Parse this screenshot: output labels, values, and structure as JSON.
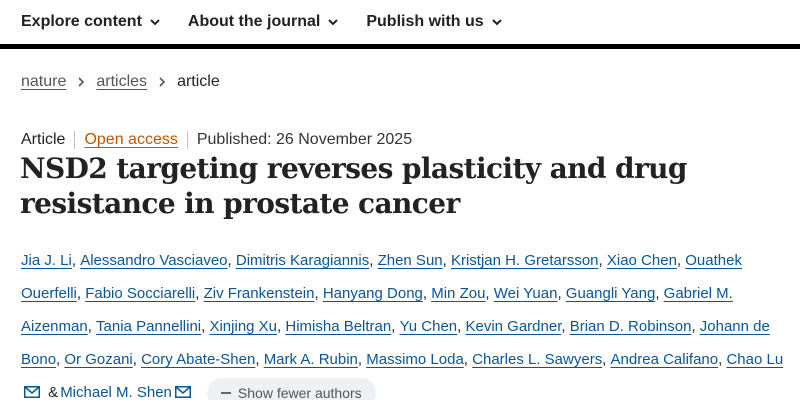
{
  "nav": {
    "items": [
      {
        "label": "Explore content"
      },
      {
        "label": "About the journal"
      },
      {
        "label": "Publish with us"
      }
    ]
  },
  "breadcrumb": [
    "nature",
    "articles",
    "article"
  ],
  "meta": {
    "type": "Article",
    "access": "Open access",
    "published": "Published: 26 November 2025"
  },
  "title": "NSD2 targeting reverses plasticity and drug resistance in prostate cancer",
  "authors": [
    "Jia J. Li",
    "Alessandro Vasciaveo",
    "Dimitris Karagiannis",
    "Zhen Sun",
    "Kristjan H. Gretarsson",
    "Xiao Chen",
    "Ouathek Ouerfelli",
    "Fabio Socciarelli",
    "Ziv Frankenstein",
    "Hanyang Dong",
    "Min Zou",
    "Wei Yuan",
    "Guangli Yang",
    "Gabriel M. Aizenman",
    "Tania Pannellini",
    "Xinjing Xu",
    "Himisha Beltran",
    "Yu Chen",
    "Kevin Gardner",
    "Brian D. Robinson",
    "Johann de Bono",
    "Or Gozani",
    "Cory Abate-Shen",
    "Mark A. Rubin",
    "Massimo Loda",
    "Charles L. Sawyers",
    "Andrea Califano",
    "Chao Lu"
  ],
  "last_author": "Michael M. Shen",
  "ampersand": "&",
  "show_fewer_label": "Show fewer authors",
  "colors": {
    "link": "#0a5596",
    "open_access": "#c05500",
    "nav_rule": "#000000",
    "pill_bg": "#eef1f4"
  },
  "icons": {
    "nav_dropdown": "chevron-down-icon",
    "breadcrumb_separator": "chevron-right-icon",
    "email": "envelope-icon",
    "collapse": "minus-icon"
  }
}
